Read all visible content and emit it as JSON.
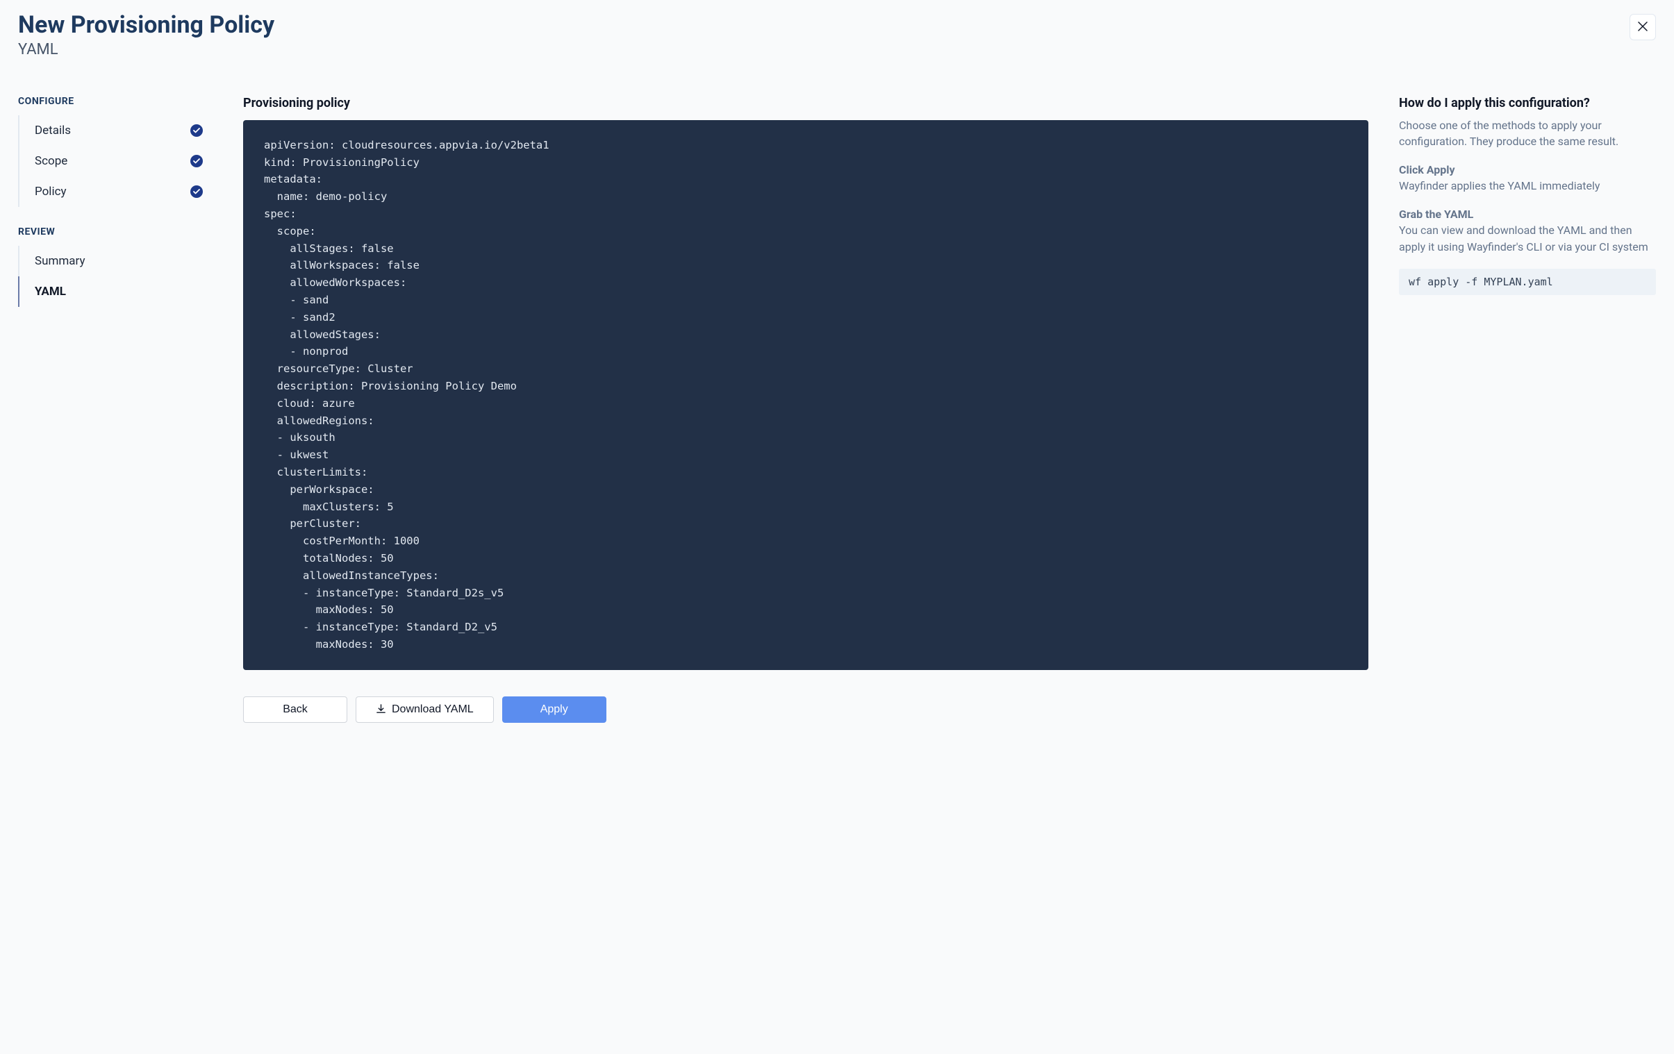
{
  "header": {
    "title": "New Provisioning Policy",
    "subtitle": "YAML"
  },
  "sidebar": {
    "configure_label": "CONFIGURE",
    "review_label": "REVIEW",
    "configure_items": [
      {
        "label": "Details",
        "complete": true
      },
      {
        "label": "Scope",
        "complete": true
      },
      {
        "label": "Policy",
        "complete": true
      }
    ],
    "review_items": [
      {
        "label": "Summary",
        "active": false
      },
      {
        "label": "YAML",
        "active": true
      }
    ]
  },
  "center": {
    "heading": "Provisioning policy",
    "yaml": "apiVersion: cloudresources.appvia.io/v2beta1\nkind: ProvisioningPolicy\nmetadata:\n  name: demo-policy\nspec:\n  scope:\n    allStages: false\n    allWorkspaces: false\n    allowedWorkspaces:\n    - sand\n    - sand2\n    allowedStages:\n    - nonprod\n  resourceType: Cluster\n  description: Provisioning Policy Demo\n  cloud: azure\n  allowedRegions:\n  - uksouth\n  - ukwest\n  clusterLimits:\n    perWorkspace:\n      maxClusters: 5\n    perCluster:\n      costPerMonth: 1000\n      totalNodes: 50\n      allowedInstanceTypes:\n      - instanceType: Standard_D2s_v5\n        maxNodes: 50\n      - instanceType: Standard_D2_v5\n        maxNodes: 30"
  },
  "buttons": {
    "back": "Back",
    "download": "Download YAML",
    "apply": "Apply"
  },
  "help": {
    "heading": "How do I apply this configuration?",
    "intro": "Choose one of the methods to apply your configuration. They produce the same result.",
    "method1_title": "Click Apply",
    "method1_desc": "Wayfinder applies the YAML immediately",
    "method2_title": "Grab the YAML",
    "method2_desc": "You can view and download the YAML and then apply it using Wayfinder's CLI or via your CI system",
    "command": "wf apply -f MYPLAN.yaml"
  }
}
